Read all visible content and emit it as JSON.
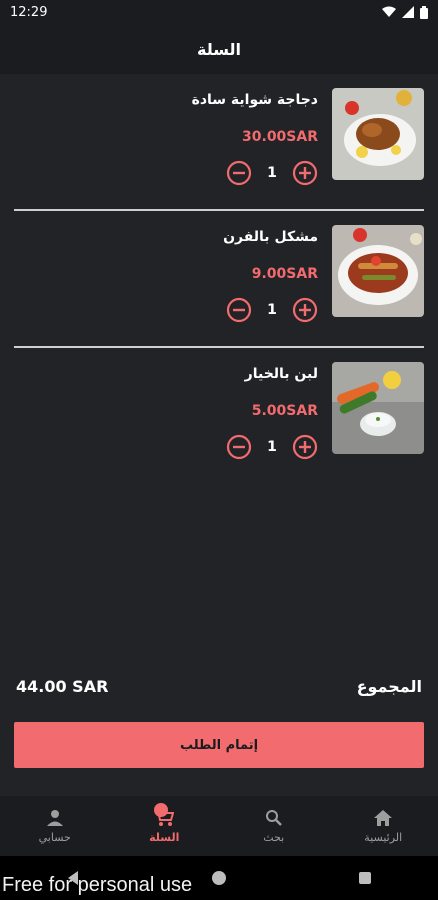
{
  "status": {
    "time": "12:29"
  },
  "header": {
    "title": "السلة"
  },
  "cart": {
    "items": [
      {
        "name": "دجاجة شواية سادة",
        "price": "30.00SAR",
        "qty": "1"
      },
      {
        "name": "مشكل بالفرن",
        "price": "9.00SAR",
        "qty": "1"
      },
      {
        "name": "لبن بالخيار",
        "price": "5.00SAR",
        "qty": "1"
      }
    ]
  },
  "summary": {
    "total_label": "المجموع",
    "total_value": "44.00 SAR"
  },
  "checkout": {
    "label": "إتمام الطلب"
  },
  "bottom_nav": {
    "items": [
      {
        "label": "حسابي",
        "icon": "person-icon"
      },
      {
        "label": "السلة",
        "icon": "cart-icon",
        "badge": ""
      },
      {
        "label": "بحث",
        "icon": "search-icon"
      },
      {
        "label": "الرئيسية",
        "icon": "home-icon"
      }
    ]
  },
  "watermark": "Free for personal use",
  "colors": {
    "accent": "#f26b6e",
    "background": "#222326",
    "bar": "#1b1c1f"
  }
}
